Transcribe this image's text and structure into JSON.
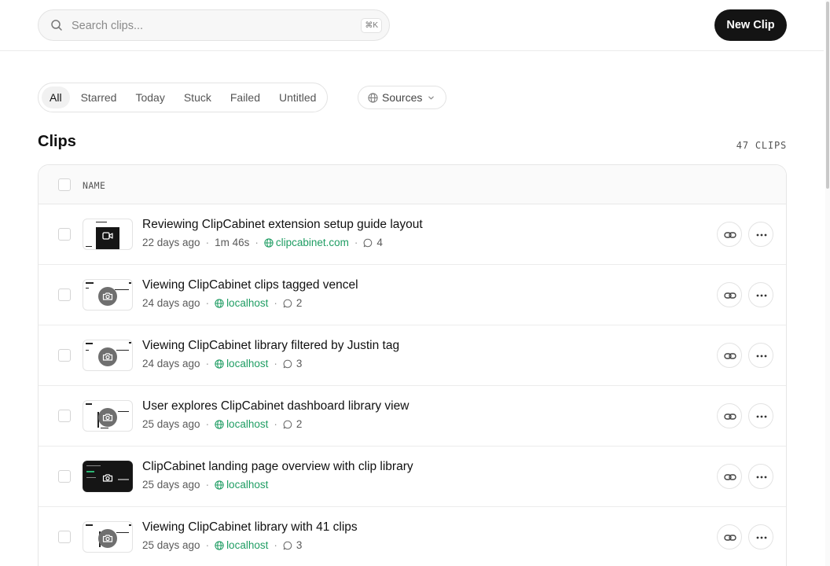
{
  "header": {
    "search_placeholder": "Search clips...",
    "search_shortcut": "⌘K",
    "new_clip_label": "New Clip"
  },
  "filters": {
    "tabs": [
      "All",
      "Starred",
      "Today",
      "Stuck",
      "Failed",
      "Untitled"
    ],
    "active": "All",
    "sources_label": "Sources"
  },
  "section": {
    "title": "Clips",
    "count": "47 CLIPS"
  },
  "table": {
    "column_name": "NAME",
    "rows": [
      {
        "title": "Reviewing ClipCabinet extension setup guide layout",
        "age": "22 days ago",
        "duration": "1m 46s",
        "site": "clipcabinet.com",
        "comments": "4",
        "thumb": "video"
      },
      {
        "title": "Viewing ClipCabinet clips tagged vencel",
        "age": "24 days ago",
        "duration": "",
        "site": "localhost",
        "comments": "2",
        "thumb": "light"
      },
      {
        "title": "Viewing ClipCabinet library filtered by Justin tag",
        "age": "24 days ago",
        "duration": "",
        "site": "localhost",
        "comments": "3",
        "thumb": "light"
      },
      {
        "title": "User explores ClipCabinet dashboard library view",
        "age": "25 days ago",
        "duration": "",
        "site": "localhost",
        "comments": "2",
        "thumb": "light"
      },
      {
        "title": "ClipCabinet landing page overview with clip library",
        "age": "25 days ago",
        "duration": "",
        "site": "localhost",
        "comments": "",
        "thumb": "dark"
      },
      {
        "title": "Viewing ClipCabinet library with 41 clips",
        "age": "25 days ago",
        "duration": "",
        "site": "localhost",
        "comments": "3",
        "thumb": "light"
      }
    ]
  },
  "icons": {
    "search": "search-icon",
    "sources": "globe-icon",
    "link": "link-icon",
    "more": "more-horizontal-icon",
    "camera": "camera-icon",
    "video": "video-icon",
    "comment": "comment-icon"
  },
  "colors": {
    "primary_button": "#141414",
    "site_link": "#1f9d63"
  }
}
